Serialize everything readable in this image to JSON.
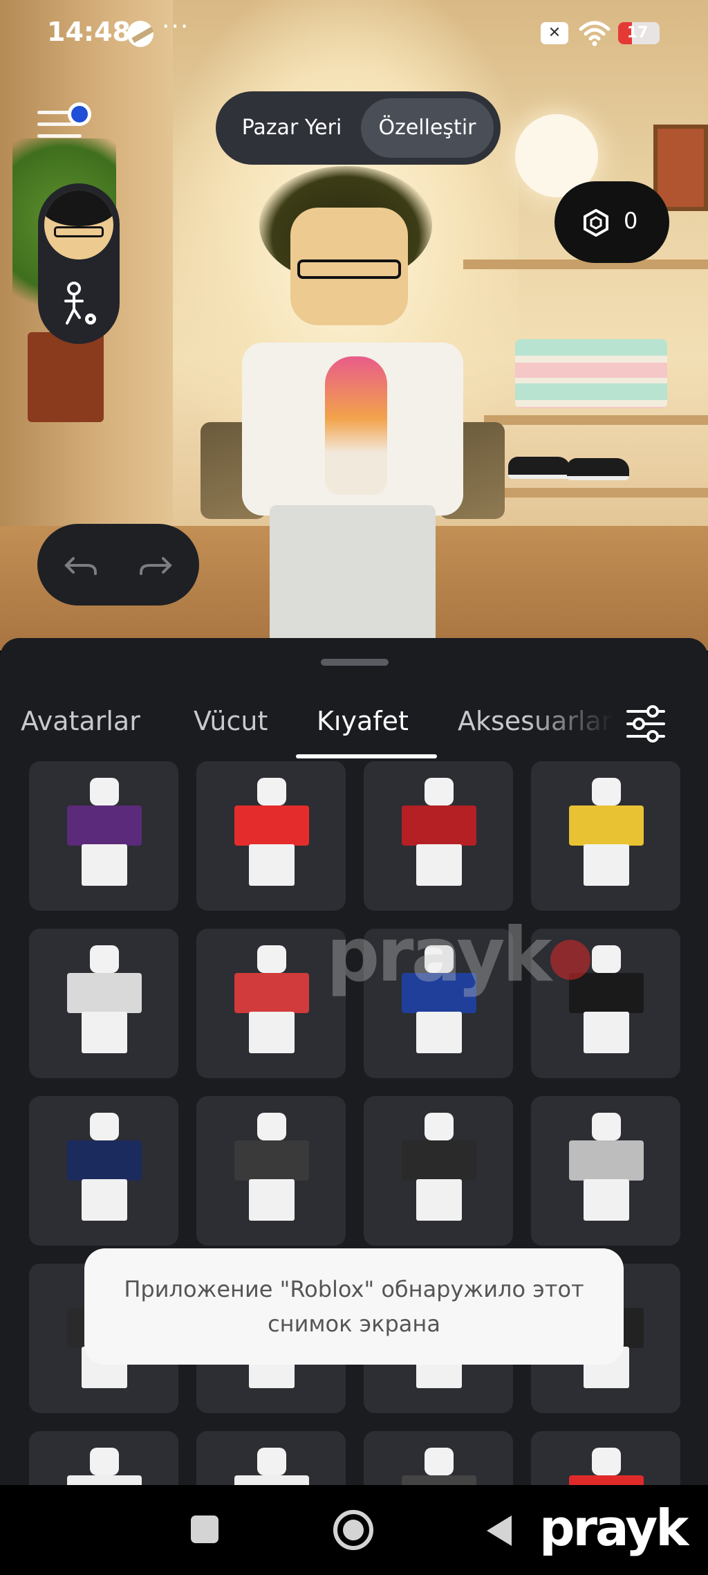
{
  "status_bar": {
    "time": "14:48",
    "more": "···",
    "battery_level": "17"
  },
  "top_nav": {
    "marketplace_label": "Pazar Yeri",
    "customize_label": "Özelleştir",
    "active": "customize"
  },
  "robux": {
    "icon": "robux-icon",
    "balance": "0"
  },
  "tabs": [
    {
      "label": "Avatarlar"
    },
    {
      "label": "Vücut"
    },
    {
      "label": "Kıyafet"
    },
    {
      "label": "Aksesuarlar"
    }
  ],
  "active_tab_index": 2,
  "items": [
    {
      "torso_color": "#5b2a7a"
    },
    {
      "torso_color": "#e52c2c"
    },
    {
      "torso_color": "#b52024"
    },
    {
      "torso_color": "#e8c233"
    },
    {
      "torso_color": "#d9d9d9"
    },
    {
      "torso_color": "#d23b3b"
    },
    {
      "torso_color": "#1f3f9a"
    },
    {
      "torso_color": "#1a1a1a"
    },
    {
      "torso_color": "#1c2b5e"
    },
    {
      "torso_color": "#3a3a3a"
    },
    {
      "torso_color": "#2a2a2a"
    },
    {
      "torso_color": "#bdbdbd"
    },
    {
      "torso_color": "#2a2a2a"
    },
    {
      "torso_color": "#e6e6e6"
    },
    {
      "torso_color": "#e6e6e6"
    },
    {
      "torso_color": "#222222"
    },
    {
      "torso_color": "#eeeeee"
    },
    {
      "torso_color": "#eeeeee"
    },
    {
      "torso_color": "#444444"
    },
    {
      "torso_color": "#e02a2a"
    }
  ],
  "toast": {
    "line1": "Приложение \"Roblox\" обнаружило этот",
    "line2": "снимок экрана"
  },
  "watermark": "prayk",
  "brand": "prayk",
  "colors": {
    "sheet_bg": "#1b1c20",
    "tile_bg": "#2c2e33",
    "notification_dot": "#1e4fd6",
    "brand_dot": "#e3202b"
  }
}
